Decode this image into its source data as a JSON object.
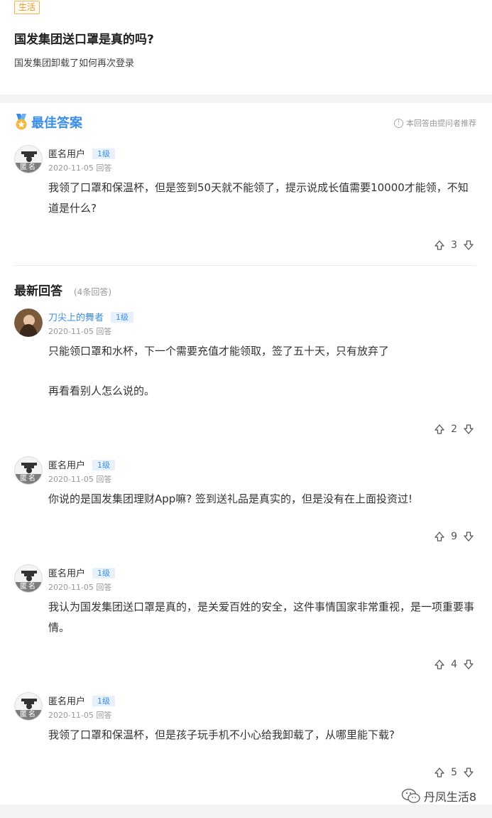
{
  "question": {
    "tag": "生活",
    "title": "国发集团送口罩是真的吗?",
    "description": "国发集团卸载了如何再次登录"
  },
  "best_answer": {
    "heading": "最佳答案",
    "note": "本回答由提问者推荐",
    "user": "匿名用户",
    "avatar_badge": "匿名",
    "level": "1级",
    "date": "2020-11-05 回答",
    "content": "我领了口罩和保温杯，但是签到50天就不能领了，提示说成长值需要10000才能领，不知道是什么?",
    "votes": "3"
  },
  "latest": {
    "heading": "最新回答",
    "count": "(4条回答)",
    "answers": [
      {
        "user": "刀尖上的舞者",
        "level": "1级",
        "date": "2020-11-05 回答",
        "content_line1": "只能领口罩和水杯，下一个需要充值才能领取，签了五十天，只有放弃了",
        "content_line2": "再看看别人怎么说的。",
        "votes": "2"
      },
      {
        "user": "匿名用户",
        "avatar_badge": "匿名",
        "level": "1级",
        "date": "2020-11-05 回答",
        "content": "你说的是国发集团理财App嘛? 签到送礼品是真实的，但是没有在上面投资过!",
        "votes": "9"
      },
      {
        "user": "匿名用户",
        "avatar_badge": "匿名",
        "level": "1级",
        "date": "2020-11-05 回答",
        "content": "我认为国发集团送口罩是真的，是关爱百姓的安全，这件事情国家非常重视，是一项重要事情。",
        "votes": "4"
      },
      {
        "user": "匿名用户",
        "avatar_badge": "匿名",
        "level": "1级",
        "date": "2020-11-05 回答",
        "content": "我领了口罩和保温杯，但是孩子玩手机不小心给我卸载了，从哪里能下载?",
        "votes": "5"
      }
    ]
  },
  "watermark": "丹凤生活8",
  "colors": {
    "accent": "#3a8ee6",
    "tag": "#e89a2b",
    "anon_badge": "#7d7d7d"
  }
}
